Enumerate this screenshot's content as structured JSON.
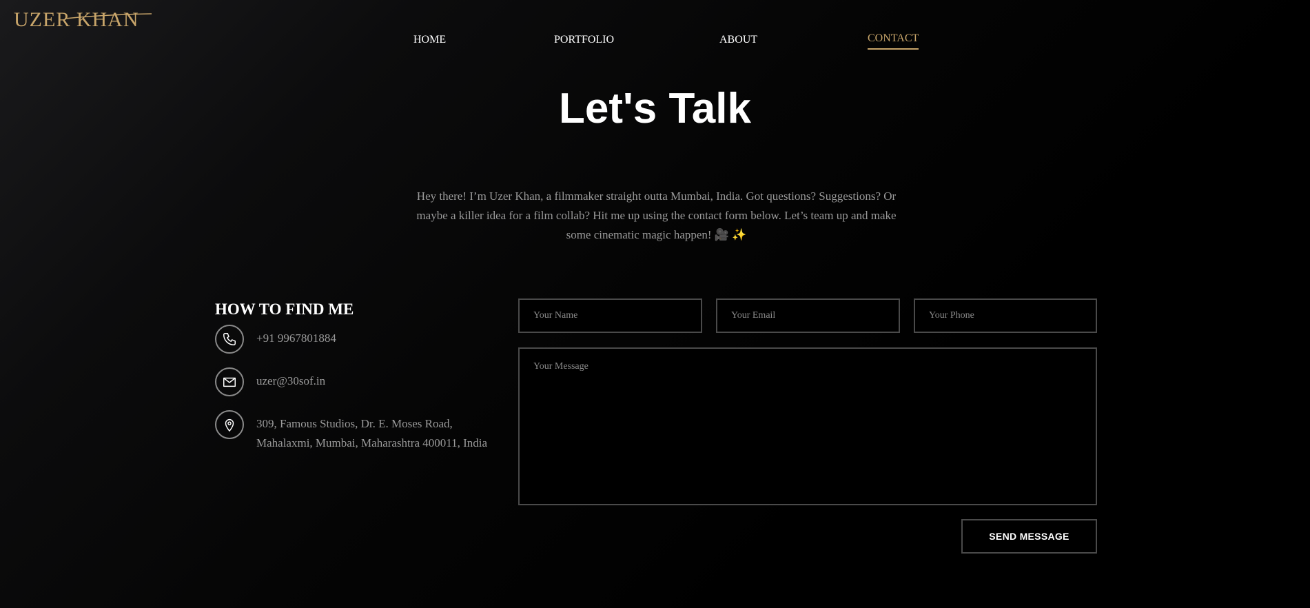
{
  "brand": {
    "logo_text": "UZER KHAN",
    "accent_color": "#c8a56a"
  },
  "nav": {
    "items": [
      {
        "label": "HOME",
        "active": false
      },
      {
        "label": "PORTFOLIO",
        "active": false
      },
      {
        "label": "ABOUT",
        "active": false
      },
      {
        "label": "CONTACT",
        "active": true
      }
    ]
  },
  "hero": {
    "title": "Let's Talk",
    "intro": "Hey there! I’m Uzer Khan, a filmmaker straight outta Mumbai, India. Got questions? Suggestions? Or maybe a killer idea for a film collab? Hit me up using the contact form below. Let’s team up and make some cinematic magic happen! 🎥 ✨"
  },
  "find_me": {
    "title": "HOW TO FIND ME",
    "items": [
      {
        "icon": "phone-icon",
        "text": "+91 9967801884"
      },
      {
        "icon": "mail-icon",
        "text": "uzer@30sof.in"
      },
      {
        "icon": "location-pin-icon",
        "text": "309, Famous Studios, Dr. E. Moses Road, Mahalaxmi, Mumbai, Maharashtra 400011, India"
      }
    ]
  },
  "form": {
    "name_placeholder": "Your Name",
    "email_placeholder": "Your Email",
    "phone_placeholder": "Your Phone",
    "message_placeholder": "Your Message",
    "submit_label": "SEND MESSAGE"
  }
}
